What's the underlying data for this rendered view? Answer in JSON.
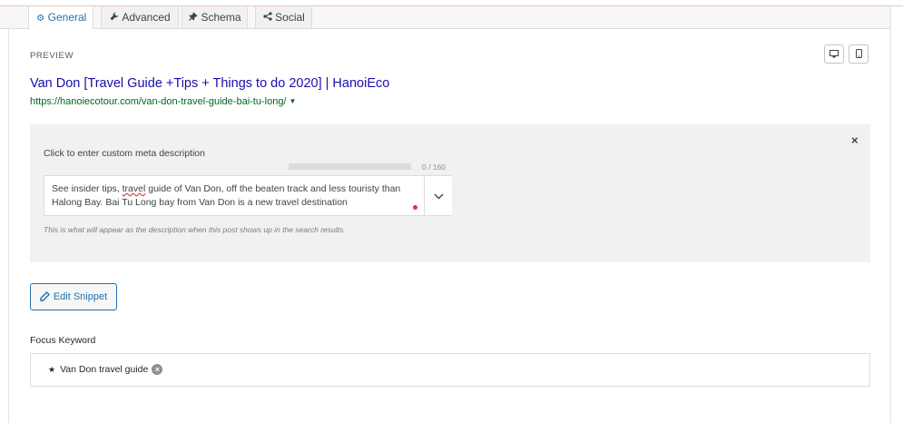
{
  "tabs": [
    {
      "label": "General",
      "icon": "gear-icon",
      "active": true
    },
    {
      "label": "Advanced",
      "icon": "wrench-icon",
      "active": false
    },
    {
      "label": "Schema",
      "icon": "pin-icon",
      "active": false
    },
    {
      "label": "Social",
      "icon": "share-icon",
      "active": false
    }
  ],
  "preview": {
    "label": "PREVIEW",
    "title": "Van Don [Travel Guide +Tips + Things to do 2020] | HanoiEco",
    "url": "https://hanoiecotour.com/van-don-travel-guide-bai-tu-long/",
    "url_arrow": "▼",
    "device_icons": [
      "desktop-icon",
      "mobile-icon"
    ]
  },
  "meta": {
    "heading": "Click to enter custom meta description",
    "close": "×",
    "progress": 0,
    "counter": "0 / 160",
    "description_before": "See insider tips, ",
    "description_misspelled": "travel",
    "description_after": " guide of Van Don, off the beaten track and less touristy than Halong Bay. Bai Tu Long bay from Van Don is a new travel destination",
    "help": "This is what will appear as the description when this post shows up in the search results."
  },
  "edit_button": {
    "label": "Edit Snippet",
    "icon": "pencil-icon"
  },
  "focus": {
    "label": "Focus Keyword",
    "keyword": "Van Don travel guide",
    "star": "★",
    "remove": "×"
  },
  "colors": {
    "accent": "#2271b1",
    "title_link": "#1a0dab",
    "url_green": "#006621",
    "error_red": "#d63638"
  }
}
